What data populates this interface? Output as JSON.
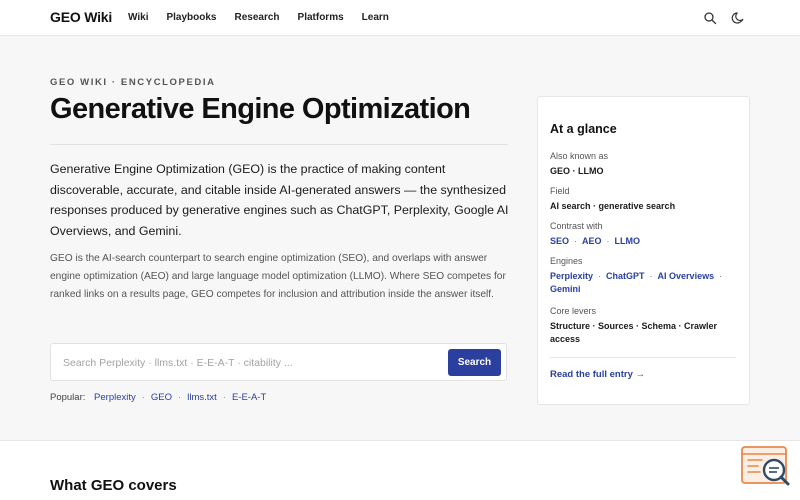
{
  "header": {
    "logo": "GEO Wiki",
    "nav": [
      "Wiki",
      "Playbooks",
      "Research",
      "Platforms",
      "Learn"
    ],
    "icons": [
      "search-icon",
      "moon-icon"
    ]
  },
  "hero": {
    "eyebrow": "GEO WIKI · ENCYCLOPEDIA",
    "title": "Generative Engine Optimization",
    "lead": "Generative Engine Optimization (GEO) is the practice of making content discoverable, accurate, and citable inside AI-generated answers — the synthesized responses produced by generative engines such as ChatGPT, Perplexity, Google AI Overviews, and Gemini.",
    "body": "GEO is the AI-search counterpart to search engine optimization (SEO), and overlaps with answer engine optimization (AEO) and large language model optimization (LLMO). Where SEO competes for ranked links on a results page, GEO competes for inclusion and attribution inside the answer itself.",
    "search": {
      "placeholder": "Search Perplexity · llms.txt · E-E-A-T · citability ...",
      "value": "",
      "button": "Search"
    },
    "popular": {
      "label": "Popular:",
      "links": [
        "Perplexity",
        "GEO",
        "llms.txt",
        "E-E-A-T"
      ]
    }
  },
  "glance": {
    "title": "At a glance",
    "also_known_as": {
      "label": "Also known as",
      "value": "GEO · LLMO"
    },
    "field": {
      "label": "Field",
      "value": "AI search · generative search"
    },
    "contrast": {
      "label": "Contrast with",
      "links": [
        "SEO",
        "AEO",
        "LLMO"
      ]
    },
    "engines": {
      "label": "Engines",
      "links": [
        "Perplexity",
        "ChatGPT",
        "AI Overviews",
        "Gemini"
      ]
    },
    "levers": {
      "label": "Core levers",
      "value": "Structure · Sources · Schema · Crawler access"
    },
    "cta": "Read the full entry →"
  },
  "section": {
    "title": "What GEO covers"
  },
  "colors": {
    "accent": "#2b3f9e",
    "widget_orange": "#e8894a",
    "widget_navy": "#2f4a6b"
  }
}
